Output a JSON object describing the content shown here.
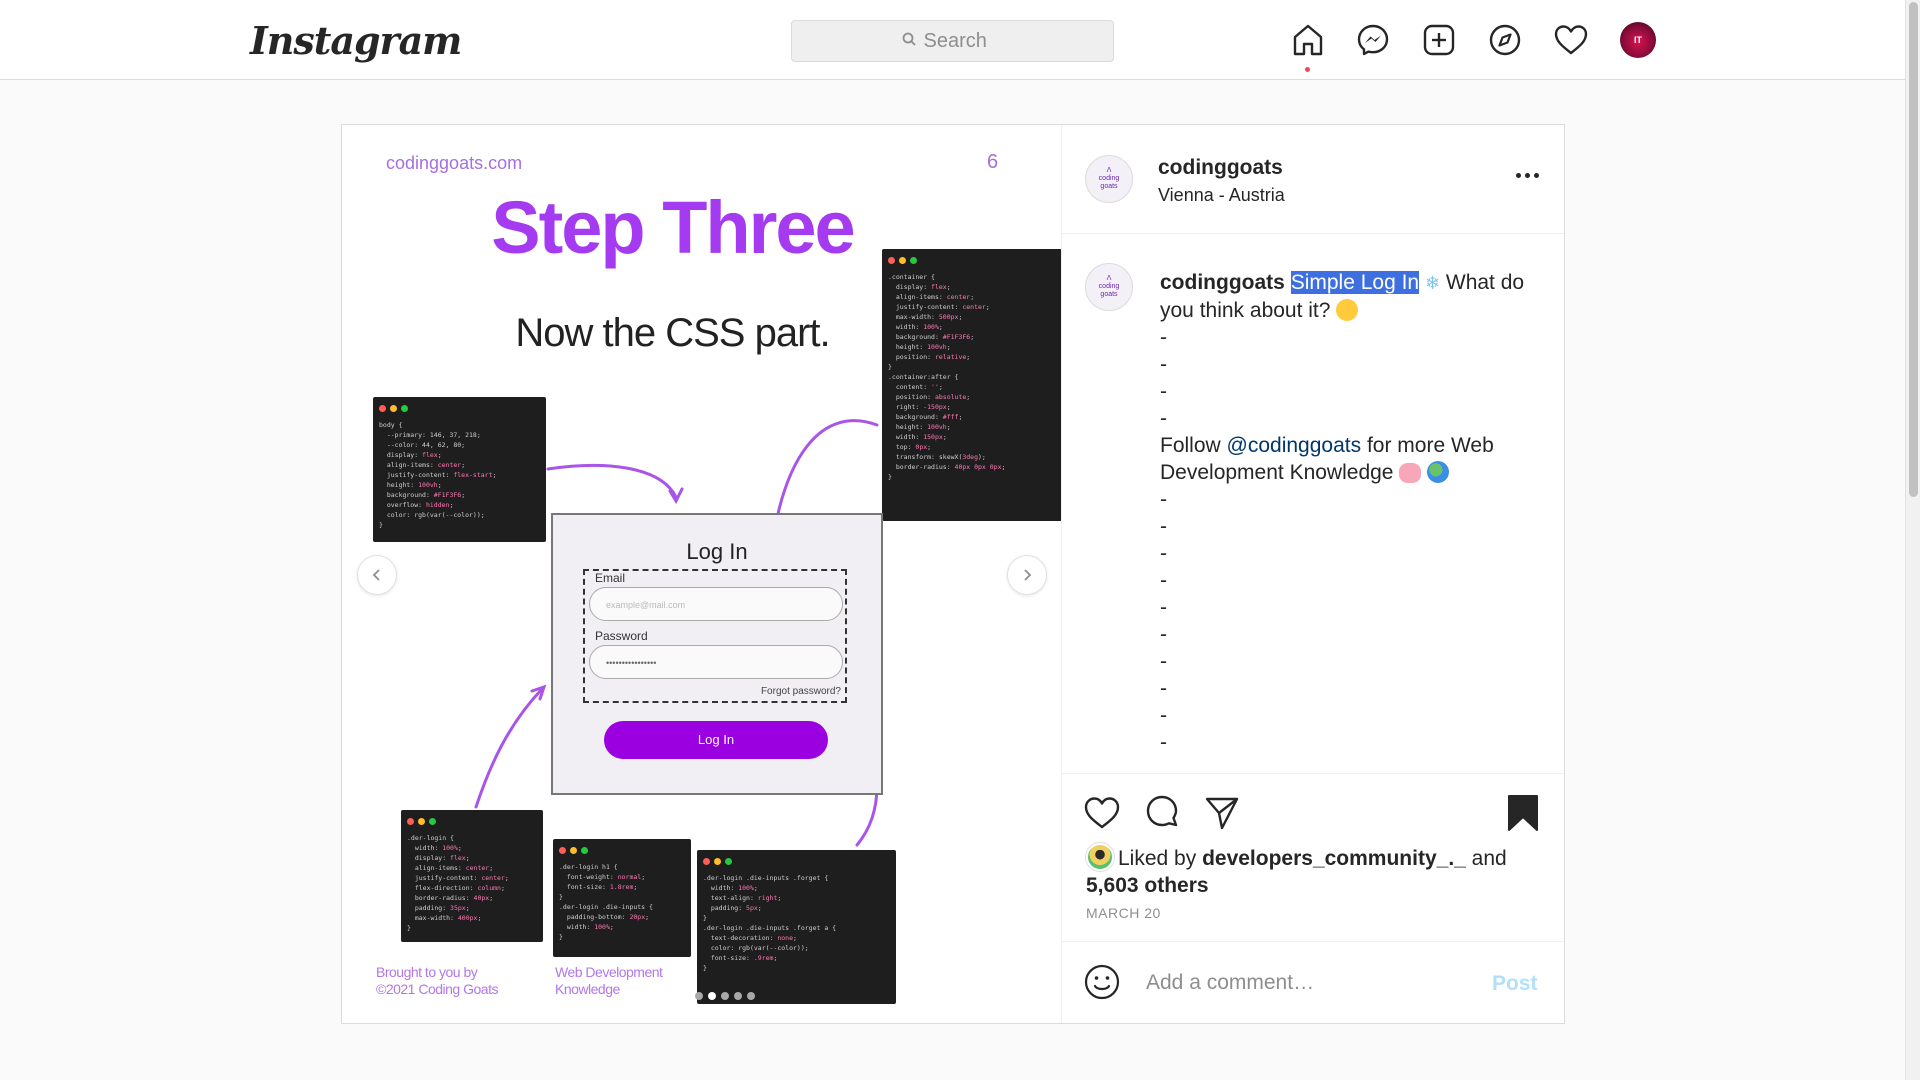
{
  "nav": {
    "logo": "Instagram",
    "search_placeholder": "Search",
    "icons": [
      "home-icon",
      "messenger-icon",
      "new-post-icon",
      "explore-icon",
      "activity-heart-icon",
      "profile-avatar"
    ],
    "notification_color": "#ed4956"
  },
  "slide": {
    "site": "codinggoats.com",
    "number": "6",
    "title": "Step Three",
    "subtitle": "Now the CSS part.",
    "login_title": "Log In",
    "email_label": "Email",
    "email_placeholder": "example@mail.com",
    "password_label": "Password",
    "password_value": "••••••••••••••••",
    "forgot": "Forgot password?",
    "login_button": "Log In",
    "credit_left": "Brought to you by\n©2021 Coding Goats",
    "credit_right": "Web Development\nKnowledge",
    "accent_color": "#a53bf0",
    "carousel_total": 5,
    "carousel_active": 2
  },
  "post": {
    "username": "codinggoats",
    "location": "Vienna - Austria",
    "caption_user": "codinggoats",
    "caption_highlight": "Simple Log In",
    "caption_after": " What do you think about it? ",
    "follow_prefix": "Follow ",
    "mention": "@codinggoats",
    "follow_suffix": " for more Web Development Knowledge ",
    "dash": "-",
    "liked_prefix": "Liked by ",
    "liked_user": "developers_community_._",
    "liked_and": " and",
    "liked_others": "5,603 others",
    "date": "MARCH 20",
    "comment_placeholder": "Add a comment…",
    "post_button": "Post",
    "saved": true
  }
}
